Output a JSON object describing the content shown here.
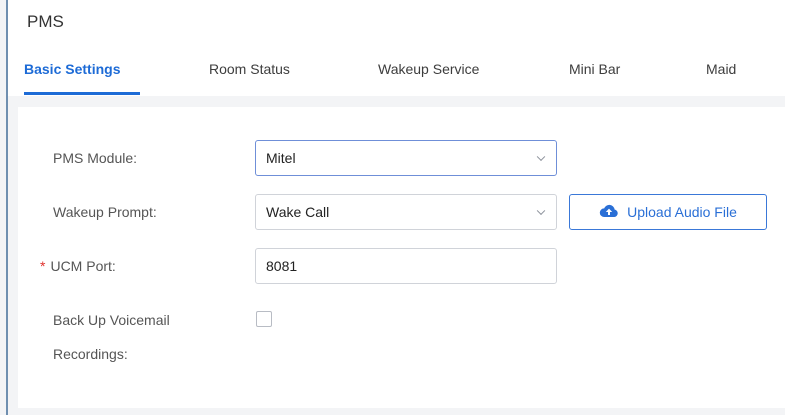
{
  "page": {
    "title": "PMS"
  },
  "tabs": [
    {
      "label": "Basic Settings",
      "active": true
    },
    {
      "label": "Room Status",
      "active": false
    },
    {
      "label": "Wakeup Service",
      "active": false
    },
    {
      "label": "Mini Bar",
      "active": false
    },
    {
      "label": "Maid",
      "active": false
    }
  ],
  "form": {
    "pms_module": {
      "label": "PMS Module:",
      "value": "Mitel"
    },
    "wakeup_prompt": {
      "label": "Wakeup Prompt:",
      "value": "Wake Call"
    },
    "upload_button": {
      "label": "Upload Audio File",
      "icon": "cloud-upload-icon"
    },
    "ucm_port": {
      "required_mark": "*",
      "label": "UCM Port:",
      "value": "8081"
    },
    "backup_voicemail": {
      "label_line1": "Back Up Voicemail",
      "label_line2": "Recordings:",
      "checked": false
    }
  },
  "colors": {
    "accent": "#1d6bd6",
    "required": "#e0312d"
  }
}
